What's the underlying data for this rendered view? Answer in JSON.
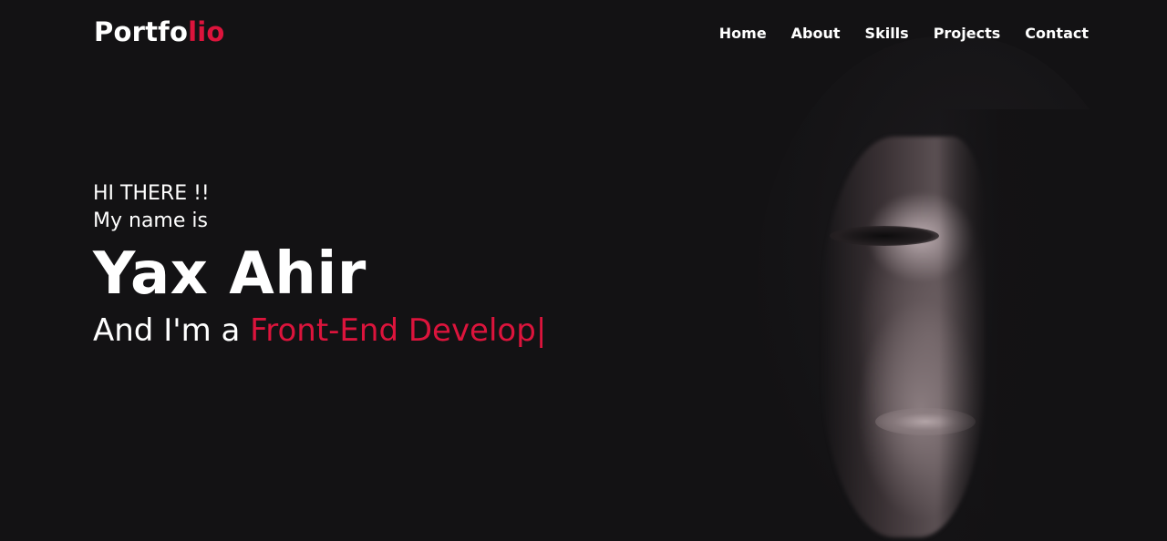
{
  "brand": {
    "logo_main": "Portfo",
    "logo_accent": "lio",
    "accent_color": "#dc143c"
  },
  "nav": {
    "items": [
      {
        "label": "Home"
      },
      {
        "label": "About"
      },
      {
        "label": "Skills"
      },
      {
        "label": "Projects"
      },
      {
        "label": "Contact"
      }
    ]
  },
  "hero": {
    "greeting": "HI THERE !!",
    "intro": "My name is",
    "name": "Yax Ahir",
    "role_prefix": "And I'm a ",
    "role_typed": "Front-End Develop",
    "cursor": "|"
  },
  "colors": {
    "background": "#131214",
    "text": "#ffffff",
    "accent": "#dc143c"
  }
}
